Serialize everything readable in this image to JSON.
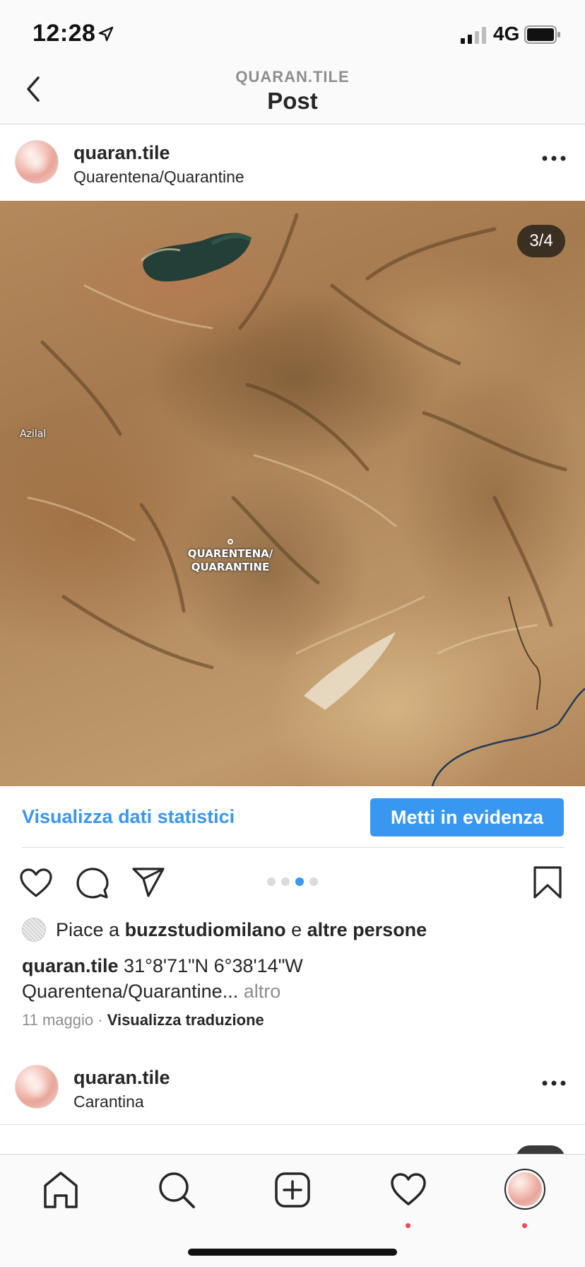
{
  "status_bar": {
    "time": "12:28",
    "network": "4G"
  },
  "nav": {
    "account_label": "QUARAN.TILE",
    "title": "Post"
  },
  "post": {
    "username": "quaran.tile",
    "location": "Quarentena/Quarantine",
    "page_counter": "3/4",
    "map_labels": {
      "town": "Azilal",
      "place_line1": "QUARENTENA/",
      "place_line2": "QUARANTINE"
    },
    "carousel": {
      "total": 4,
      "active_index": 2
    },
    "insights_label": "Visualizza dati statistici",
    "promote_label": "Metti in evidenza",
    "likes": {
      "prefix": "Piace a",
      "user": "buzzstudiomilano",
      "connector": "e",
      "others": "altre persone"
    },
    "caption": {
      "username": "quaran.tile",
      "line1": "31°8'71\"N 6°38'14\"W",
      "line2": "Quarentena/Quarantine...",
      "more": "altro"
    },
    "date": "11 maggio",
    "separator": "·",
    "translate_label": "Visualizza traduzione"
  },
  "next_post": {
    "username": "quaran.tile",
    "location": "Carantina"
  },
  "tabbar": {
    "icons": [
      "home-icon",
      "search-icon",
      "new-post-icon",
      "heart-icon",
      "profile-avatar"
    ],
    "notification_color": "#ed4956"
  },
  "colors": {
    "accent": "#3897f0",
    "text": "#262626",
    "muted": "#8e8e8e"
  }
}
